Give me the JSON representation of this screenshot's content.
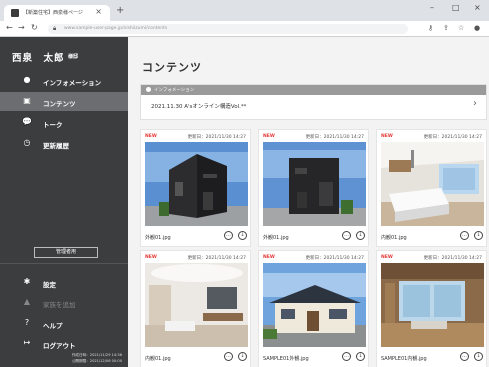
{
  "browser": {
    "tab_title": "【新築住宅】西泉様ページ",
    "url_text": "www.sample-user-page.jp/nishiizumi/contents",
    "tab_close": "×",
    "new_tab": "+",
    "win_min": "–",
    "win_max": "□",
    "win_close": "×"
  },
  "sidebar": {
    "user_name": "西泉　太郎",
    "user_role": "様邸",
    "items": [
      {
        "label": "インフォメーション",
        "icon": "●"
      },
      {
        "label": "コンテンツ",
        "icon": "▣"
      },
      {
        "label": "トーク",
        "icon": "💬"
      },
      {
        "label": "更新履歴",
        "icon": "◷"
      }
    ],
    "admin_button": "管理者用",
    "bottom_items": [
      {
        "label": "設定",
        "icon": "✱"
      },
      {
        "label": "家族を追加",
        "icon": "▲"
      },
      {
        "label": "ヘルプ",
        "icon": "?"
      },
      {
        "label": "ログアウト",
        "icon": "↦"
      }
    ],
    "footer_created": "作成日時：2021/11/29 14:36",
    "footer_published": "公開期限：2021/12/06 00:00"
  },
  "main": {
    "title": "コンテンツ",
    "info": {
      "header": "インフォメーション",
      "text": "2021.11.30 A'sオンライン構造Vol.**",
      "arrow": "›"
    },
    "cards": [
      {
        "new": "NEW",
        "date": "更新日：2021/11/30 14:27",
        "name": "外観01.jpg",
        "thumb": "dark-house"
      },
      {
        "new": "NEW",
        "date": "更新日：2021/11/30 14:27",
        "name": "外観01.jpg",
        "thumb": "dark-house-front"
      },
      {
        "new": "NEW",
        "date": "更新日：2021/11/30 14:27",
        "name": "内観01.jpg",
        "thumb": "kitchen"
      },
      {
        "new": "NEW",
        "date": "更新日：2021/11/30 14:27",
        "name": "内観01.jpg",
        "thumb": "living-room"
      },
      {
        "new": "NEW",
        "date": "更新日：2021/11/30 14:27",
        "name": "SAMPLE01外観.jpg",
        "thumb": "tile-roof-house"
      },
      {
        "new": "NEW",
        "date": "更新日：2021/11/30 14:27",
        "name": "SAMPLE01内観.jpg",
        "thumb": "wood-interior"
      }
    ],
    "comment_icon": "…",
    "download_icon": "↓"
  },
  "colors": {
    "sidebar_bg": "#3b3d3f",
    "active_item": "#6b6d70",
    "new_badge": "#e53935",
    "info_header": "#9a9a9a"
  }
}
